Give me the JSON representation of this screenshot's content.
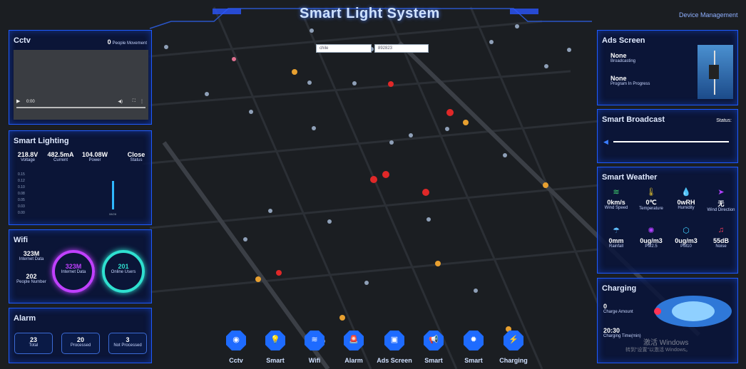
{
  "header": {
    "title": "Smart Light System",
    "device_mgmt": "Device Management"
  },
  "search": {
    "left": "chile",
    "right": "892823"
  },
  "cctv": {
    "title": "Cctv",
    "count": "0",
    "count_label": "People Movement",
    "time": "0:00"
  },
  "lighting": {
    "title": "Smart Lighting",
    "metrics": [
      {
        "value": "218.8V",
        "label": "Voltage"
      },
      {
        "value": "482.5mA",
        "label": "Current"
      },
      {
        "value": "104.08W",
        "label": "Power"
      },
      {
        "value": "Close",
        "label": "Status"
      }
    ],
    "y_ticks": [
      "0.15",
      "0.12",
      "0.10",
      "0.08",
      "0.05",
      "0.03",
      "0.00"
    ],
    "x_tick": "08/28"
  },
  "wifi": {
    "title": "Wifi",
    "internet_value": "323M",
    "internet_label": "Internet Data",
    "people_value": "202",
    "people_label": "People Number",
    "gauge1_value": "323M",
    "gauge1_label": "Internet Data",
    "gauge2_value": "201",
    "gauge2_label": "Online Users"
  },
  "alarm": {
    "title": "Alarm",
    "boxes": [
      {
        "value": "23",
        "label": "Total"
      },
      {
        "value": "20",
        "label": "Processed"
      },
      {
        "value": "3",
        "label": "Not Processed"
      }
    ]
  },
  "ads": {
    "title": "Ads Screen",
    "row1_value": "None",
    "row1_label": "Broadcasting",
    "row2_value": "None",
    "row2_label": "Program In Progress"
  },
  "broadcast": {
    "title": "Smart Broadcast",
    "status": "Status:"
  },
  "weather": {
    "title": "Smart Weather",
    "items": [
      {
        "value": "0km/s",
        "label": "Wind Speed",
        "icon": "wind-icon"
      },
      {
        "value": "0℃",
        "label": "Temperature",
        "icon": "thermometer-icon"
      },
      {
        "value": "0wRH",
        "label": "Humidity",
        "icon": "droplet-icon"
      },
      {
        "value": "无",
        "label": "Wind Direction",
        "icon": "direction-icon"
      },
      {
        "value": "0mm",
        "label": "Rainfall",
        "icon": "rain-icon"
      },
      {
        "value": "0ug/m3",
        "label": "PM2.5",
        "icon": "pm25-icon"
      },
      {
        "value": "0ug/m3",
        "label": "PM10",
        "icon": "pm10-icon"
      },
      {
        "value": "55dB",
        "label": "Noise",
        "icon": "noise-icon"
      }
    ]
  },
  "charging": {
    "title": "Charging",
    "amount_value": "0",
    "amount_label": "Charge Amount",
    "time_value": "20:30",
    "time_label": "Charging Time(min)"
  },
  "watermark": {
    "line1": "激活 Windows",
    "line2": "转到\"设置\"以激活 Windows。"
  },
  "nav": [
    "Cctv",
    "Smart Lighting",
    "Wifi",
    "Alarm",
    "Ads Screen",
    "Smart Broadcast",
    "Smart Weather",
    "Charging"
  ],
  "colors": {
    "accent": "#1e5aff",
    "panel": "#08143c",
    "gauge1": "#c040ff",
    "gauge2": "#2fe0d0",
    "marker_red": "#e02828",
    "marker_orange": "#e8a030"
  }
}
